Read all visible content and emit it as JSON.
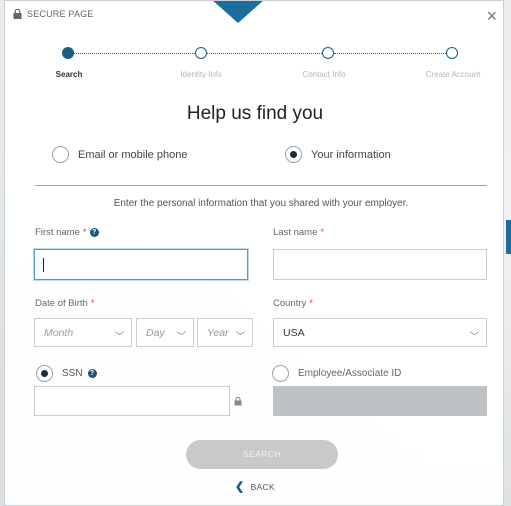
{
  "header": {
    "secure_label": "SECURE PAGE",
    "close_glyph": "×"
  },
  "stepper": {
    "steps": [
      {
        "label": "Search",
        "state": "active"
      },
      {
        "label": "Identity Info",
        "state": "todo"
      },
      {
        "label": "Contact Info",
        "state": "todo"
      },
      {
        "label": "Create Account",
        "state": "todo"
      }
    ]
  },
  "title": "Help us find you",
  "lookup_options": {
    "email": {
      "label": "Email or mobile phone",
      "selected": false
    },
    "info": {
      "label": "Your information",
      "selected": true
    }
  },
  "instructions": "Enter the personal information that you shared with your employer.",
  "form": {
    "first_name": {
      "label": "First name",
      "required_mark": "*",
      "value": ""
    },
    "last_name": {
      "label": "Last name",
      "required_mark": "*",
      "value": ""
    },
    "dob": {
      "label": "Date of Birth",
      "required_mark": "*",
      "month": "Month",
      "day": "Day",
      "year": "Year"
    },
    "country": {
      "label": "Country",
      "required_mark": "*",
      "value": "USA"
    },
    "ssn": {
      "label": "SSN",
      "selected": true,
      "value": ""
    },
    "employee_id": {
      "label": "Employee/Associate ID",
      "selected": false
    }
  },
  "actions": {
    "search_label": "SEARCH",
    "back_label": "BACK",
    "back_glyph": "❮"
  },
  "colors": {
    "accent": "#1a6d9c",
    "step_active": "#1a5e80",
    "required": "#d04848",
    "button_disabled": "#c9c9c9"
  },
  "icons": [
    "lock-icon",
    "close-icon",
    "help-icon",
    "chevron-down-icon",
    "chevron-left-icon"
  ]
}
